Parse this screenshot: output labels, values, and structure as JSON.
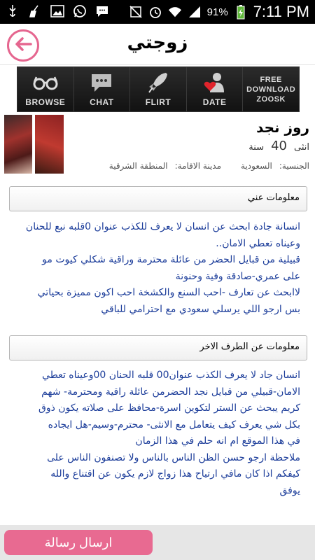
{
  "status_bar": {
    "battery_percent": "91%",
    "time": "7:11 PM",
    "icons": [
      "usb-icon",
      "cleaner-icon",
      "image-icon",
      "whatsapp-icon",
      "sms-icon",
      "mute-icon",
      "alarm-icon",
      "wifi-icon",
      "signal-icon",
      "battery-charging-icon"
    ]
  },
  "app_bar": {
    "title": "زوجتي",
    "accent_color": "#e5668f"
  },
  "banner": {
    "items": [
      {
        "label": "BROWSE",
        "icon": "glasses-icon"
      },
      {
        "label": "CHAT",
        "icon": "chat-bubble-icon"
      },
      {
        "label": "FLIRT",
        "icon": "rocket-icon"
      },
      {
        "label": "DATE",
        "icon": "person-heart-icon"
      },
      {
        "label_line1": "FREE",
        "label_line2": "DOWNLOAD",
        "label_line3": "ZOOSK"
      }
    ]
  },
  "profile": {
    "name": "روز نجد",
    "gender": "انثى",
    "age": "40",
    "age_unit": "سنة",
    "nationality_label": "الجنسية:",
    "nationality_value": "السعودية",
    "city_label": "مدينة الاقامة:",
    "city_value": "المنطقة الشرقية"
  },
  "about_me": {
    "title": "معلومات عني",
    "lines": [
      "انسانة جادة ابحث عن انسان لا يعرف للكذب عنوان 0قلبه نبع للحنان",
      "وعيناه تعطي الامان..",
      "قبيلية من قبايل الحضر من عائلة محترمة وراقية شكلي كيوت مو",
      "على عمري-صادقة وفية وحنونة",
      "لاابحث عن تعارف -احب السنع والكشخة احب اكون مميزة بحياتي",
      "بس ارجو اللي يرسلي سعودي مع احترامي للباقي"
    ]
  },
  "about_partner": {
    "title": "معلومات عن الطرف الاخر",
    "lines": [
      "انسان جاد لا يعرف الكذب عنوان00 قلبه الحنان 00وعيناه تعطي",
      "الامان-قبيلي من قبايل نجد الحضرمن عائلة راقية ومحترمة- شهم",
      "كريم يبحث عن الستر لتكوين اسرة-محافظ على صلاته يكون ذوق",
      "بكل شي يعرف كيف يتعامل مع الانثى- محترم-وسيم-هل ايجاده",
      "في هذا الموقع ام انه حلم في هذا الزمان",
      "ملاحظة ارجو حسن الظن الناس بالناس ولا تصنفون الناس على",
      "كيفكم اذا كان مافي ارتياح هذا زواج لازم يكون عن اقتناع والله",
      "يوفق"
    ]
  },
  "footer": {
    "send_message_label": "ارسال رسالة",
    "button_color": "#e86a91"
  }
}
